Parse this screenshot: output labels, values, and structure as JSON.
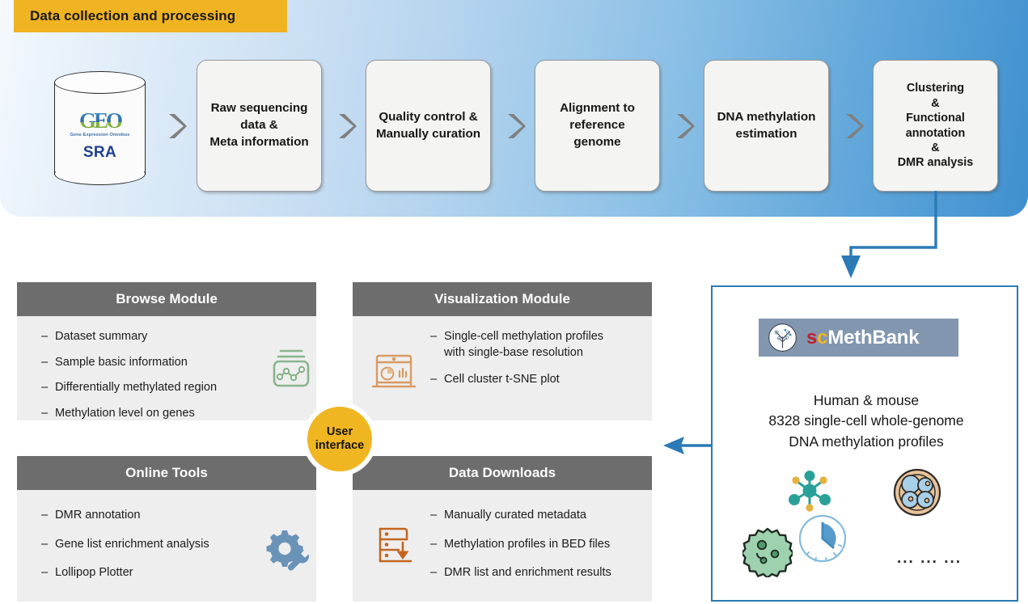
{
  "banner": {
    "title": "Data collection and processing",
    "source_db": {
      "geo_word": "GEO",
      "geo_subtitle": "Gene Expression Omnibus",
      "sra_label": "SRA"
    },
    "stages": [
      "Raw sequencing\ndata &\nMeta information",
      "Quality control &\nManually curation",
      "Alignment to\nreference\ngenome",
      "DNA methylation\nestimation",
      "Clustering\n&\nFunctional\nannotation\n&\nDMR analysis"
    ]
  },
  "modules": {
    "browse": {
      "title": "Browse Module",
      "items": [
        "Dataset summary",
        "Sample basic information",
        "Differentially methylated region",
        "Methylation level on genes"
      ],
      "icon": "line-chart-box-icon",
      "icon_color": "#8ab48d"
    },
    "visualization": {
      "title": "Visualization Module",
      "items": [
        "Single-cell methylation profiles\nwith single-base resolution",
        "Cell cluster t-SNE plot"
      ],
      "icon": "monitor-charts-icon",
      "icon_color": "#d99a62"
    },
    "online_tools": {
      "title": "Online Tools",
      "items": [
        "DMR annotation",
        "Gene list enrichment analysis",
        "Lollipop Plotter"
      ],
      "icon": "gear-wrench-icon",
      "icon_color": "#6b93b8"
    },
    "data_downloads": {
      "title": "Data Downloads",
      "items": [
        "Manually curated metadata",
        "Methylation profiles in BED files",
        "DMR list and enrichment results"
      ],
      "icon": "list-download-icon",
      "icon_color": "#c4651f"
    },
    "hub_label": "User\ninterface"
  },
  "database": {
    "logo": {
      "prefix_s": "s",
      "prefix_c": "c",
      "name": "MethBank",
      "mark": "tree-circle-icon"
    },
    "description": "Human & mouse\n8328 single-cell whole-genome\nDNA methylation profiles",
    "stats": {
      "species": "Human & mouse",
      "cell_count": 8328,
      "profile_type": "single-cell whole-genome DNA methylation profiles"
    },
    "icons": [
      {
        "name": "molecule-network-icon",
        "color": "#2aa198"
      },
      {
        "name": "clock-icon",
        "color": "#3f8ec4"
      },
      {
        "name": "embryo-cells-icon",
        "color": "#9fc7e0"
      },
      {
        "name": "virus-cell-icon",
        "color": "#8fc6a0"
      }
    ],
    "ellipsis": "... ... ..."
  },
  "colors": {
    "banner_accent": "#f0b322",
    "panel_header": "#6d6d6d",
    "panel_body": "#eeeeee",
    "arrow_blue": "#2b7ab5",
    "chevron_gray": "#7f7f7f",
    "hub_gold": "#f0b622",
    "logo_bar": "#8296b0"
  }
}
